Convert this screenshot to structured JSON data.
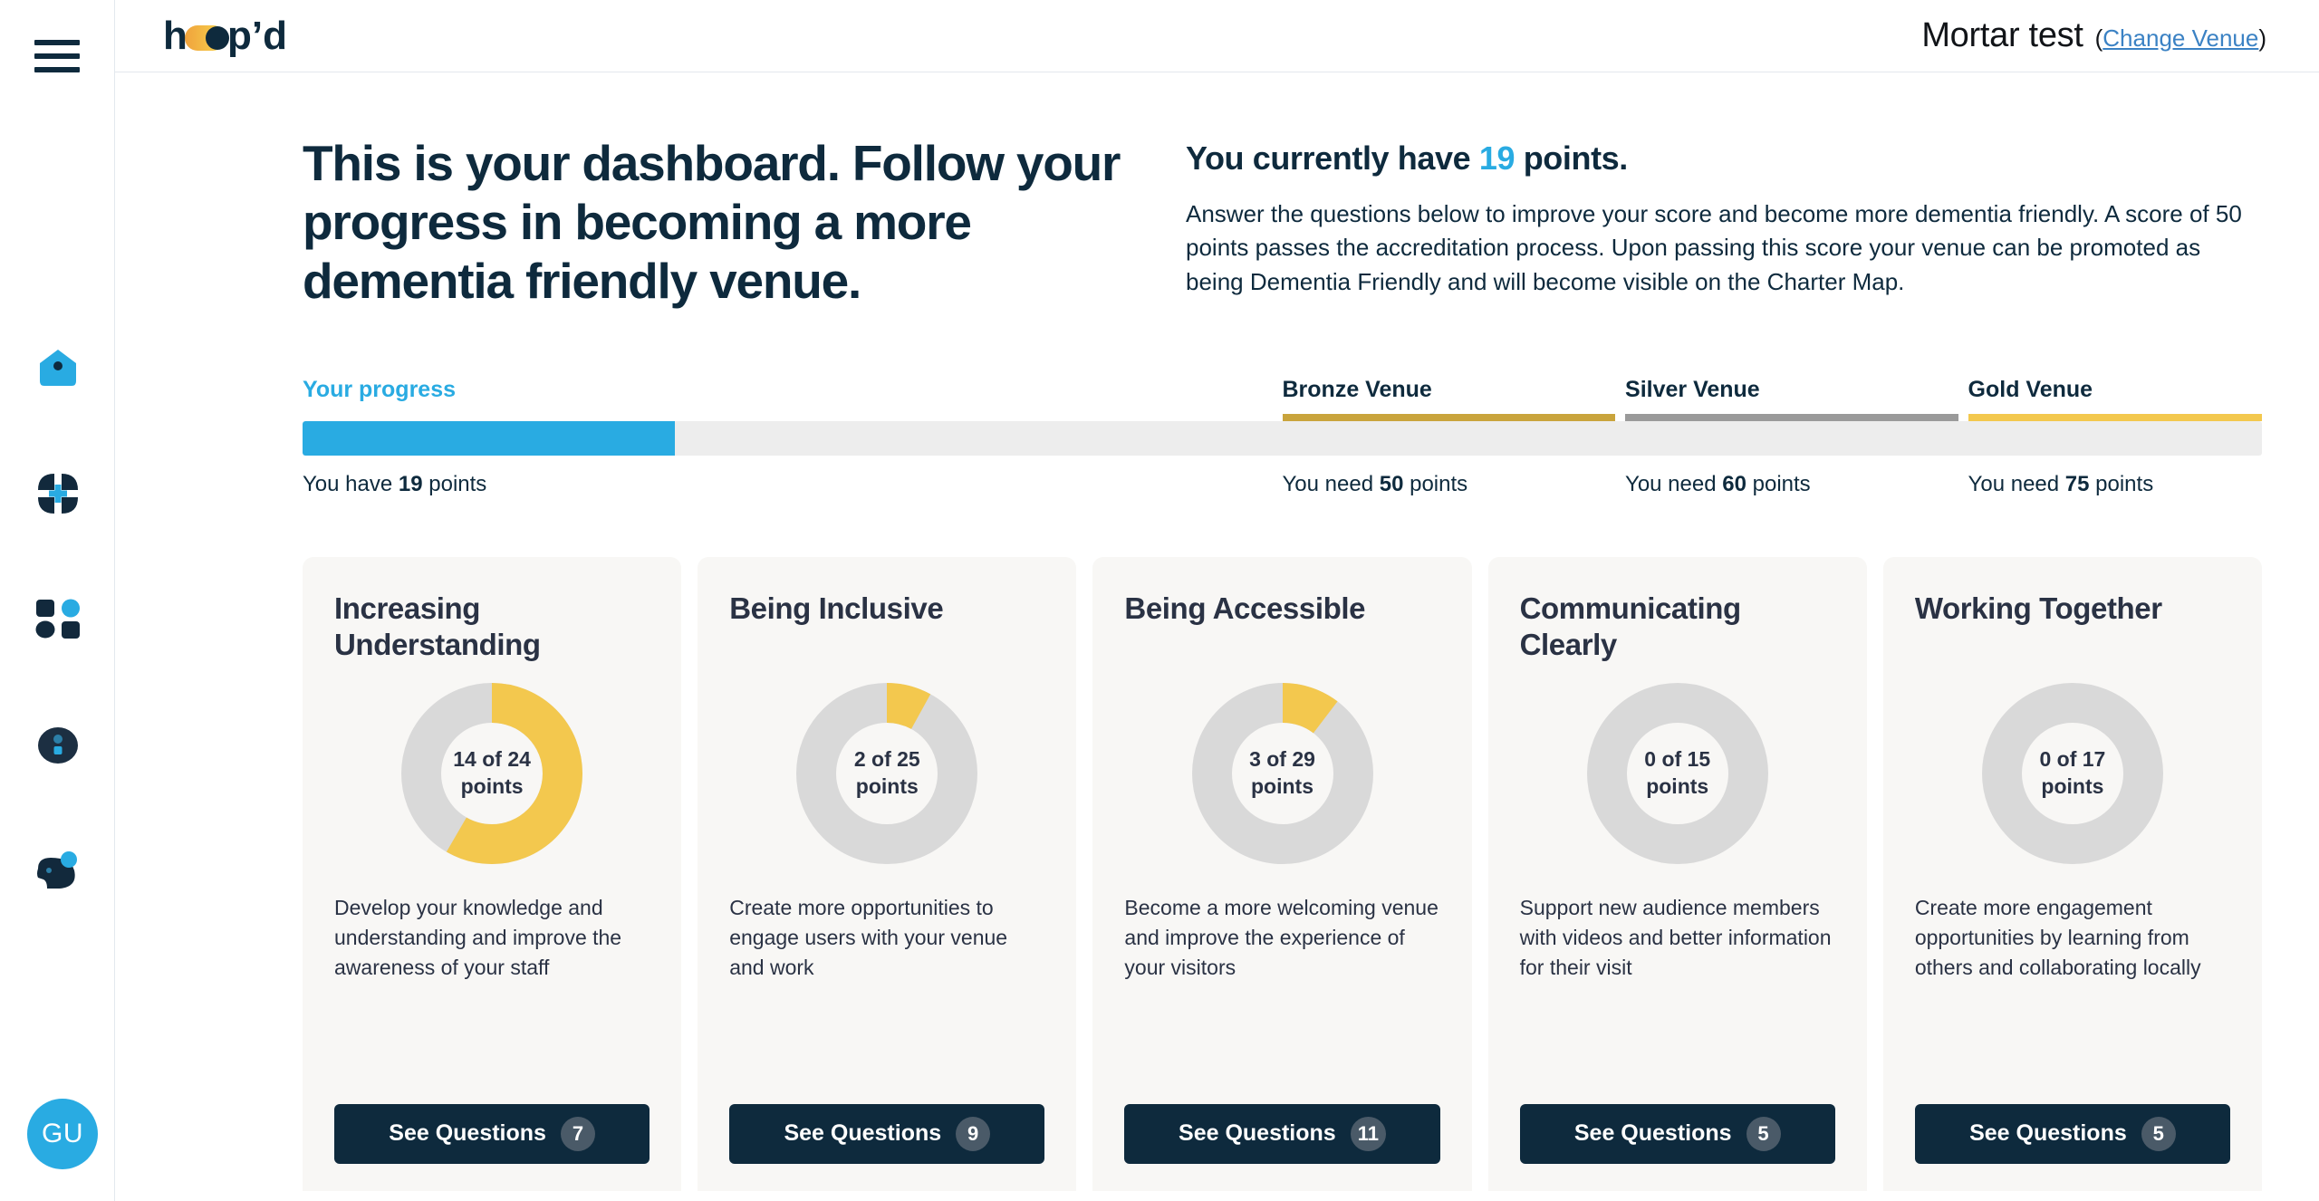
{
  "sidebar": {
    "menu_icon": "hamburger-icon",
    "items": [
      {
        "icon": "home-icon",
        "label": "Home"
      },
      {
        "icon": "flower-plus-icon",
        "label": "Categories"
      },
      {
        "icon": "grid-squares-icon",
        "label": "Dashboard"
      },
      {
        "icon": "person-info-icon",
        "label": "Profile"
      },
      {
        "icon": "bird-icon",
        "label": "Community"
      }
    ],
    "avatar_initials": "GU"
  },
  "header": {
    "logo_text": "hoop'd",
    "venue_name": "Mortar test",
    "change_venue_open": "(",
    "change_venue_link": "Change Venue",
    "change_venue_close": ")"
  },
  "hero": {
    "title": "This is your dashboard. Follow your progress in becoming a more dementia friendly venue.",
    "points_prefix": "You currently have ",
    "points_value": "19",
    "points_suffix": " points.",
    "body": "Answer the questions below to improve your score and become more dementia friendly. A score of 50 points passes the accreditation process. Upon passing this score your venue can be promoted as being Dementia Friendly and will become visible on the Charter Map."
  },
  "progress": {
    "label": "Your progress",
    "current_points": 19,
    "max_points": 100,
    "fill_percent": 19,
    "have_prefix": "You have ",
    "have_value": "19",
    "have_suffix": " points",
    "fill_color": "#29abe2",
    "track_color": "#ededed",
    "tiers": [
      {
        "name": "Bronze Venue",
        "need_prefix": "You need ",
        "need_value": "50",
        "need_suffix": " points",
        "color": "#c9a43c",
        "start_percent": 50,
        "end_percent": 67
      },
      {
        "name": "Silver Venue",
        "need_prefix": "You need ",
        "need_value": "60",
        "need_suffix": " points",
        "color": "#9a9a9a",
        "start_percent": 67.5,
        "end_percent": 84.5
      },
      {
        "name": "Gold Venue",
        "need_prefix": "You need ",
        "need_value": "75",
        "need_suffix": " points",
        "color": "#f3c84e",
        "start_percent": 85,
        "end_percent": 100
      }
    ]
  },
  "cards": [
    {
      "title": "Increasing Understanding",
      "earned": 14,
      "total": 24,
      "points_text": "14 of 24",
      "points_unit": "points",
      "description": "Develop your knowledge and understanding and improve the awareness of your staff",
      "button_label": "See Questions",
      "question_count": "7"
    },
    {
      "title": "Being Inclusive",
      "earned": 2,
      "total": 25,
      "points_text": "2 of 25",
      "points_unit": "points",
      "description": "Create more opportunities to engage users with your venue and work",
      "button_label": "See Questions",
      "question_count": "9"
    },
    {
      "title": "Being Accessible",
      "earned": 3,
      "total": 29,
      "points_text": "3 of 29",
      "points_unit": "points",
      "description": "Become a more welcoming venue and improve the experience of your visitors",
      "button_label": "See Questions",
      "question_count": "11"
    },
    {
      "title": "Communicating Clearly",
      "earned": 0,
      "total": 15,
      "points_text": "0 of 15",
      "points_unit": "points",
      "description": "Support new audience members with videos and better information for their visit",
      "button_label": "See Questions",
      "question_count": "5"
    },
    {
      "title": "Working Together",
      "earned": 0,
      "total": 17,
      "points_text": "0 of 17",
      "points_unit": "points",
      "description": "Create more engagement opportunities by learning from others and collaborating locally",
      "button_label": "See Questions",
      "question_count": "5"
    }
  ],
  "colors": {
    "accent_blue": "#29abe2",
    "navy": "#0e2a3d",
    "donut_fill": "#f3c84e",
    "donut_track": "#d9d9d9",
    "card_bg": "#f8f7f5",
    "link_blue": "#3b82c4"
  }
}
